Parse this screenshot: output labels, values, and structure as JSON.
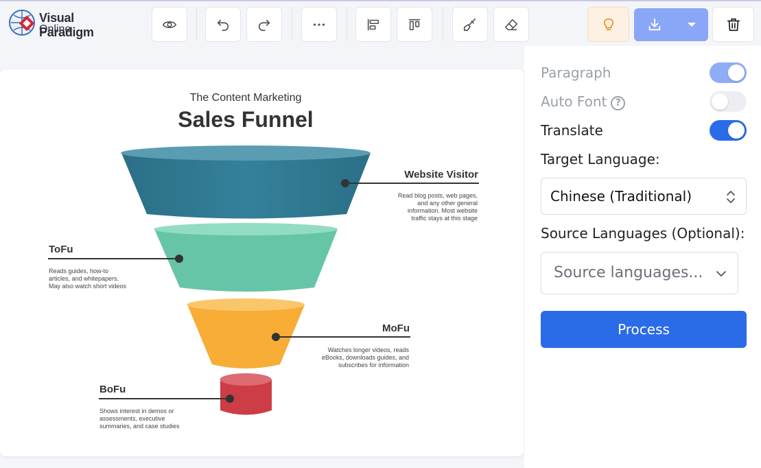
{
  "app": {
    "logo_line1": "Visual Paradigm",
    "logo_line2": "Online",
    "accent_color": "#2a6be8"
  },
  "toolbar": {
    "icons": [
      "eye-icon",
      "undo-icon",
      "redo-icon",
      "more-icon",
      "align-left-icon",
      "align-top-icon",
      "brush-icon",
      "eraser-icon",
      "bulb-icon",
      "download-icon",
      "caret-down-icon",
      "trash-icon"
    ]
  },
  "infographic": {
    "subtitle": "The Content Marketing",
    "title": "Sales Funnel",
    "stages": [
      {
        "name": "Website Visitor",
        "color": "#2f7790",
        "desc": [
          "Read blog posts, web pages,",
          "and any other general",
          "information. Most website",
          "traffic stays at this stage"
        ]
      },
      {
        "name": "ToFu",
        "color": "#66c5a6",
        "desc": [
          "Reads guides, how-to",
          "articles, and whitepapers.",
          "May also watch short videos"
        ]
      },
      {
        "name": "MoFu",
        "color": "#f7ad36",
        "desc": [
          "Watches longer videos, reads",
          "eBooks, downloads guides, and",
          "subscribes for information"
        ]
      },
      {
        "name": "BoFu",
        "color": "#cc3d47",
        "desc": [
          "Shows interest in demos or",
          "assessments, executive",
          "summaries, and case studies"
        ]
      }
    ]
  },
  "panel": {
    "paragraph_label": "Paragraph",
    "paragraph_on": true,
    "auto_font_label": "Auto Font",
    "auto_font_on": false,
    "translate_label": "Translate",
    "translate_on": true,
    "target_language_label": "Target Language:",
    "target_language_value": "Chinese (Traditional)",
    "source_languages_label": "Source Languages (Optional):",
    "source_languages_placeholder": "Source languages...",
    "process_label": "Process"
  }
}
